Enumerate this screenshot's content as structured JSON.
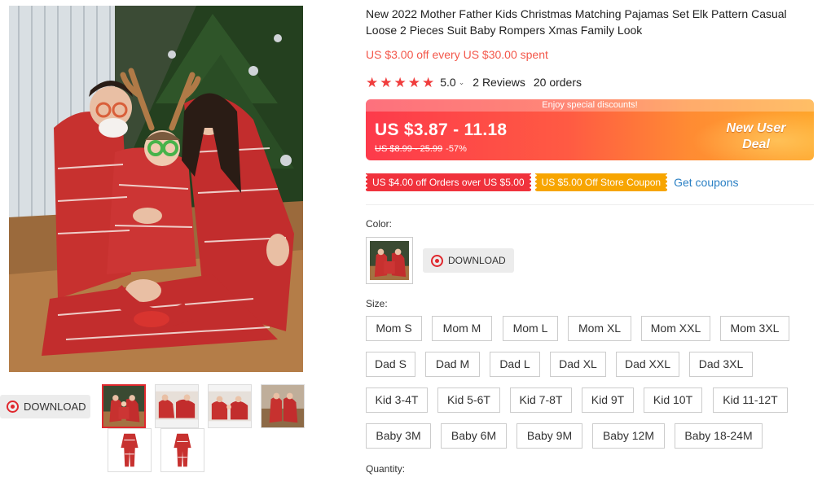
{
  "product": {
    "title": "New 2022 Mother Father Kids Christmas Matching Pajamas Set Elk Pattern Casual Loose 2 Pieces Suit Baby Rompers Xmas Family Look",
    "store_promo": "US $3.00 off every US $30.00 spent",
    "rating": "5.0",
    "stars": 5,
    "reviews_label": "2 Reviews",
    "orders_label": "20 orders"
  },
  "banner": {
    "top_text": "Enjoy special discounts!",
    "price": "US $3.87 - 11.18",
    "original_price": "US $8.99 - 25.99",
    "discount": "-57%",
    "deal_line1": "New User",
    "deal_line2": "Deal"
  },
  "coupons": {
    "items": [
      "US $4.00 off Orders over US $5.00",
      "US $5.00 Off Store Coupon"
    ],
    "get_label": "Get coupons"
  },
  "download_label": "DOWNLOAD",
  "color": {
    "label": "Color:"
  },
  "size": {
    "label": "Size:",
    "rows": [
      [
        "Mom S",
        "Mom M",
        "Mom L",
        "Mom XL",
        "Mom XXL",
        "Mom 3XL"
      ],
      [
        "Dad S",
        "Dad M",
        "Dad L",
        "Dad XL",
        "Dad XXL",
        "Dad 3XL"
      ],
      [
        "Kid 3-4T",
        "Kid 5-6T",
        "Kid 7-8T",
        "Kid 9T",
        "Kid 10T",
        "Kid 11-12T"
      ],
      [
        "Baby 3M",
        "Baby 6M",
        "Baby 9M",
        "Baby 12M",
        "Baby 18-24M"
      ]
    ]
  },
  "quantity": {
    "label": "Quantity:"
  },
  "colors": {
    "accent_red": "#e0282e",
    "promo_red": "#f3574a",
    "link_blue": "#2b80c4",
    "coupon_orange": "#f7a500"
  }
}
